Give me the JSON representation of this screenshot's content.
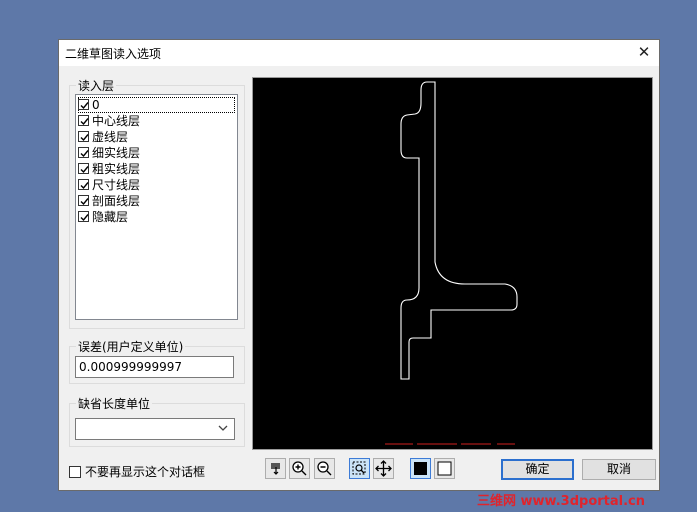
{
  "dialog": {
    "title": "二维草图读入选项",
    "close_glyph": "✕"
  },
  "layers": {
    "label": "读入层",
    "items": [
      {
        "name": "0",
        "checked": true
      },
      {
        "name": "中心线层",
        "checked": true
      },
      {
        "name": "虚线层",
        "checked": true
      },
      {
        "name": "细实线层",
        "checked": true
      },
      {
        "name": "粗实线层",
        "checked": true
      },
      {
        "name": "尺寸线层",
        "checked": true
      },
      {
        "name": "剖面线层",
        "checked": true
      },
      {
        "name": "隐藏层",
        "checked": true
      }
    ]
  },
  "tolerance": {
    "label": "误差(用户定义单位)",
    "value": "0.000999999997"
  },
  "default_unit": {
    "label": "缺省长度单位",
    "value": ""
  },
  "toolbar": {
    "icons": [
      "pick-icon",
      "zoom-in-icon",
      "zoom-out-icon",
      "zoom-window-icon",
      "pan-icon",
      "black-background-icon",
      "white-background-icon"
    ]
  },
  "footer": {
    "dont_show_label": "不要再显示这个对话框",
    "ok_label": "确定",
    "cancel_label": "取消"
  },
  "watermark": {
    "text": "三维网 www.3dportal.cn"
  },
  "colors": {
    "preview_background": "#000000",
    "preview_stroke": "#ffffff",
    "accent": "#2b6fce",
    "watermark": "#e0242c"
  }
}
